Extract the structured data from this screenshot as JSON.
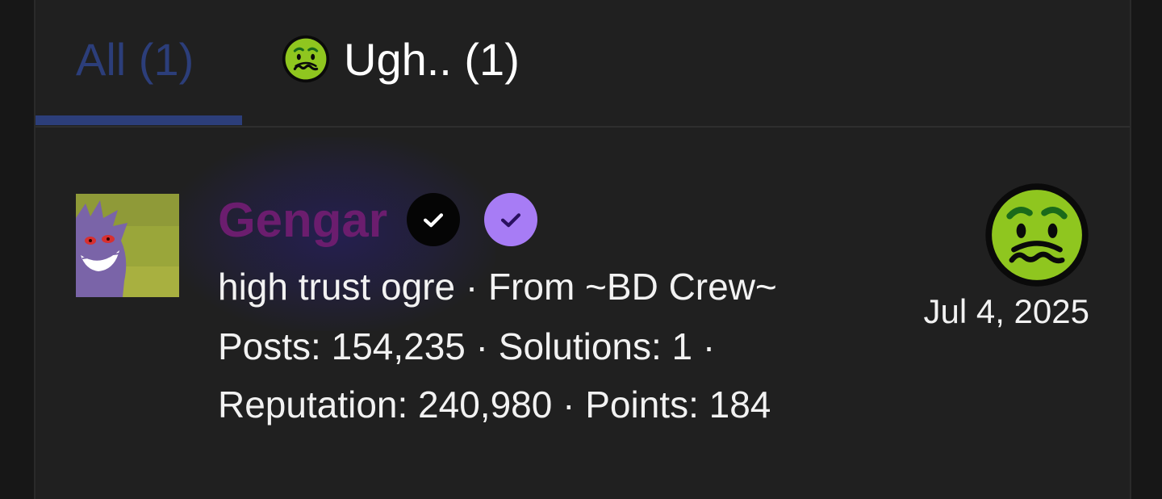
{
  "tabs": [
    {
      "label": "All (1)",
      "selected": true
    },
    {
      "label": "Ugh.. (1)",
      "emoji": "sick-face-icon",
      "selected": false
    }
  ],
  "accent_color": "#2c3e7a",
  "reaction": {
    "user": {
      "name": "Gengar",
      "name_color": "#6b1d6e",
      "avatar": "gengar-avatar",
      "badges": [
        "verified-black-check-icon",
        "verified-purple-check-icon"
      ],
      "title_line": "high trust ogre · From ~BD Crew~",
      "stats_line1": "Posts: 154,235 · Solutions: 1 ·",
      "stats_line2": "Reputation: 240,980 · Points: 184"
    },
    "emoji": "sick-face-icon",
    "date": "Jul 4, 2025"
  }
}
